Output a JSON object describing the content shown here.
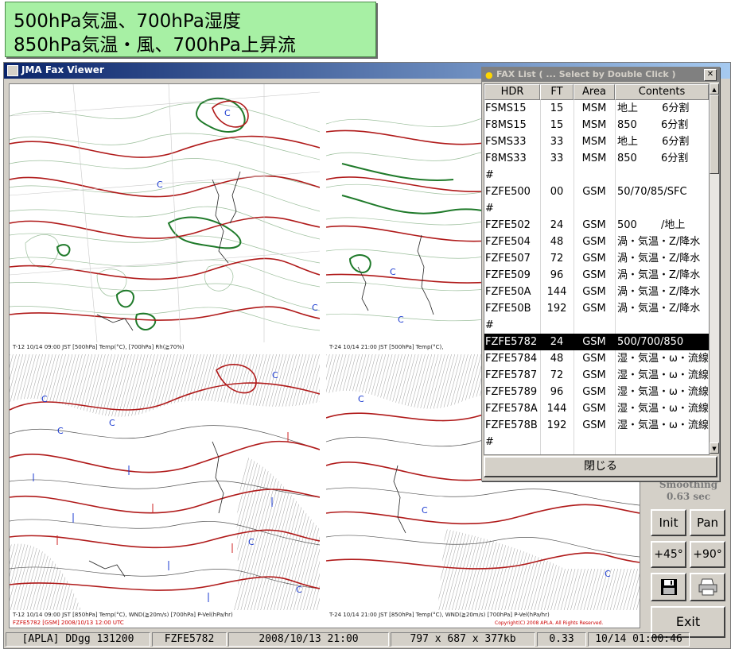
{
  "banner": {
    "line1": "500hPa気温、700hPa湿度",
    "line2": "850hPa気温・風、700hPa上昇流"
  },
  "window": {
    "title": "JMA Fax Viewer"
  },
  "maps": {
    "top_left_caption": "T-12   10/14 09:00 JST          [500hPa] Temp(°C),    [700hPa]   Rh(≧70%)",
    "top_right_caption": "T-24   10/14 21:00 JST          [500hPa] Temp(°C),",
    "bottom_left_caption": "T-12   10/14 09:00 JST          [850hPa] Temp(°C), WND(≧20m/s)          [700hPa]  P-Vel(hPa/hr)",
    "bottom_right_caption": "T-24   10/14 21:00 JST          [850hPa] Temp(°C), WND(≧20m/s)          [700hPa]  P-Vel(hPa/hr)",
    "footer_left": "FZFE5782   [GSM]   2008/10/13   12:00 UTC",
    "footer_right": "Copyright(C) 2008 APLA. All Rights Reserved."
  },
  "fax_list": {
    "title": "FAX List ( ... Select by Double Click )",
    "columns": [
      "HDR",
      "FT",
      "Area",
      "Contents"
    ],
    "rows": [
      {
        "hdr": "FSMS15",
        "ft": "15",
        "area": "MSM",
        "contents": "地上　　 6分割"
      },
      {
        "hdr": "F8MS15",
        "ft": "15",
        "area": "MSM",
        "contents": "850　　 6分割"
      },
      {
        "hdr": "FSMS33",
        "ft": "33",
        "area": "MSM",
        "contents": "地上　　 6分割"
      },
      {
        "hdr": "F8MS33",
        "ft": "33",
        "area": "MSM",
        "contents": "850　　 6分割"
      },
      {
        "hdr": "#",
        "ft": "",
        "area": "",
        "contents": ""
      },
      {
        "hdr": "FZFE500",
        "ft": "00",
        "area": "GSM",
        "contents": "50/70/85/SFC"
      },
      {
        "hdr": "#",
        "ft": "",
        "area": "",
        "contents": ""
      },
      {
        "hdr": "FZFE502",
        "ft": "24",
        "area": "GSM",
        "contents": "500　　 /地上"
      },
      {
        "hdr": "FZFE504",
        "ft": "48",
        "area": "GSM",
        "contents": "渦・気温・Z/降水"
      },
      {
        "hdr": "FZFE507",
        "ft": "72",
        "area": "GSM",
        "contents": "渦・気温・Z/降水"
      },
      {
        "hdr": "FZFE509",
        "ft": "96",
        "area": "GSM",
        "contents": "渦・気温・Z/降水"
      },
      {
        "hdr": "FZFE50A",
        "ft": "144",
        "area": "GSM",
        "contents": "渦・気温・Z/降水"
      },
      {
        "hdr": "FZFE50B",
        "ft": "192",
        "area": "GSM",
        "contents": "渦・気温・Z/降水"
      },
      {
        "hdr": "#",
        "ft": "",
        "area": "",
        "contents": ""
      },
      {
        "hdr": "FZFE5782",
        "ft": "24",
        "area": "GSM",
        "contents": "500/700/850",
        "selected": true
      },
      {
        "hdr": "FZFE5784",
        "ft": "48",
        "area": "GSM",
        "contents": "湿・気温・ω・流線"
      },
      {
        "hdr": "FZFE5787",
        "ft": "72",
        "area": "GSM",
        "contents": "湿・気温・ω・流線"
      },
      {
        "hdr": "FZFE5789",
        "ft": "96",
        "area": "GSM",
        "contents": "湿・気温・ω・流線"
      },
      {
        "hdr": "FZFE578A",
        "ft": "144",
        "area": "GSM",
        "contents": "湿・気温・ω・流線"
      },
      {
        "hdr": "FZFE578B",
        "ft": "192",
        "area": "GSM",
        "contents": "湿・気温・ω・流線"
      },
      {
        "hdr": "#",
        "ft": "",
        "area": "",
        "contents": ""
      }
    ],
    "close_label": "閉じる"
  },
  "side": {
    "smoothing_label": "Smoothing",
    "smoothing_value": "0.63 sec",
    "init": "Init",
    "pan": "Pan",
    "rot_plus45": "+45°",
    "rot_plus90": "+90°",
    "save_icon": "floppy-disk-icon",
    "print_icon": "printer-icon",
    "exit": "Exit"
  },
  "status": {
    "s1": "[APLA] DDgg 131200",
    "s2": "FZFE5782",
    "s3": "2008/10/13 21:00",
    "s4": "797 x 687 x 377kb",
    "s5": "0.33",
    "s6": "10/14 01:00:46"
  },
  "colors": {
    "title_blue": "#0a246a",
    "selected_row": "#000000",
    "banner_green": "#a7f0a4",
    "contour_red": "#b01a1a",
    "contour_green": "#1f7a2a"
  }
}
